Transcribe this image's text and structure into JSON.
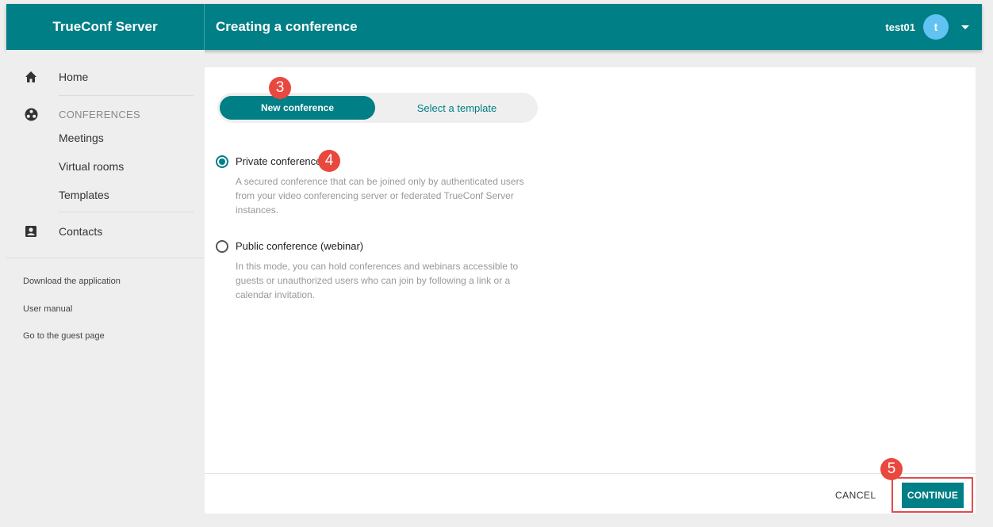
{
  "header": {
    "brand": "TrueConf Server",
    "title": "Creating a conference",
    "username": "test01",
    "avatar_letter": "t"
  },
  "sidebar": {
    "home": "Home",
    "conferences_section": "CONFERENCES",
    "meetings": "Meetings",
    "virtual_rooms": "Virtual rooms",
    "templates": "Templates",
    "contacts": "Contacts",
    "links": [
      "Download the application",
      "User manual",
      "Go to the guest page"
    ]
  },
  "main": {
    "toggle": {
      "active": "New conference",
      "inactive": "Select a template"
    },
    "options": [
      {
        "title": "Private conference",
        "description": "A secured conference that can be joined only by authenticated users from your video conferencing server or federated TrueConf Server instances.",
        "selected": true
      },
      {
        "title": "Public conference (webinar)",
        "description": "In this mode, you can hold conferences and webinars accessible to guests or unauthorized users who can join by following a link or a calendar invitation.",
        "selected": false
      }
    ],
    "cancel_label": "CANCEL",
    "continue_label": "CONTINUE"
  },
  "markers": [
    "3",
    "4",
    "5"
  ],
  "colors": {
    "primary": "#007f86",
    "avatar": "#60c3f2",
    "marker": "#e9483f"
  },
  "icons": [
    "home-icon",
    "conferences-icon",
    "contacts-icon",
    "chevron-down-icon"
  ]
}
